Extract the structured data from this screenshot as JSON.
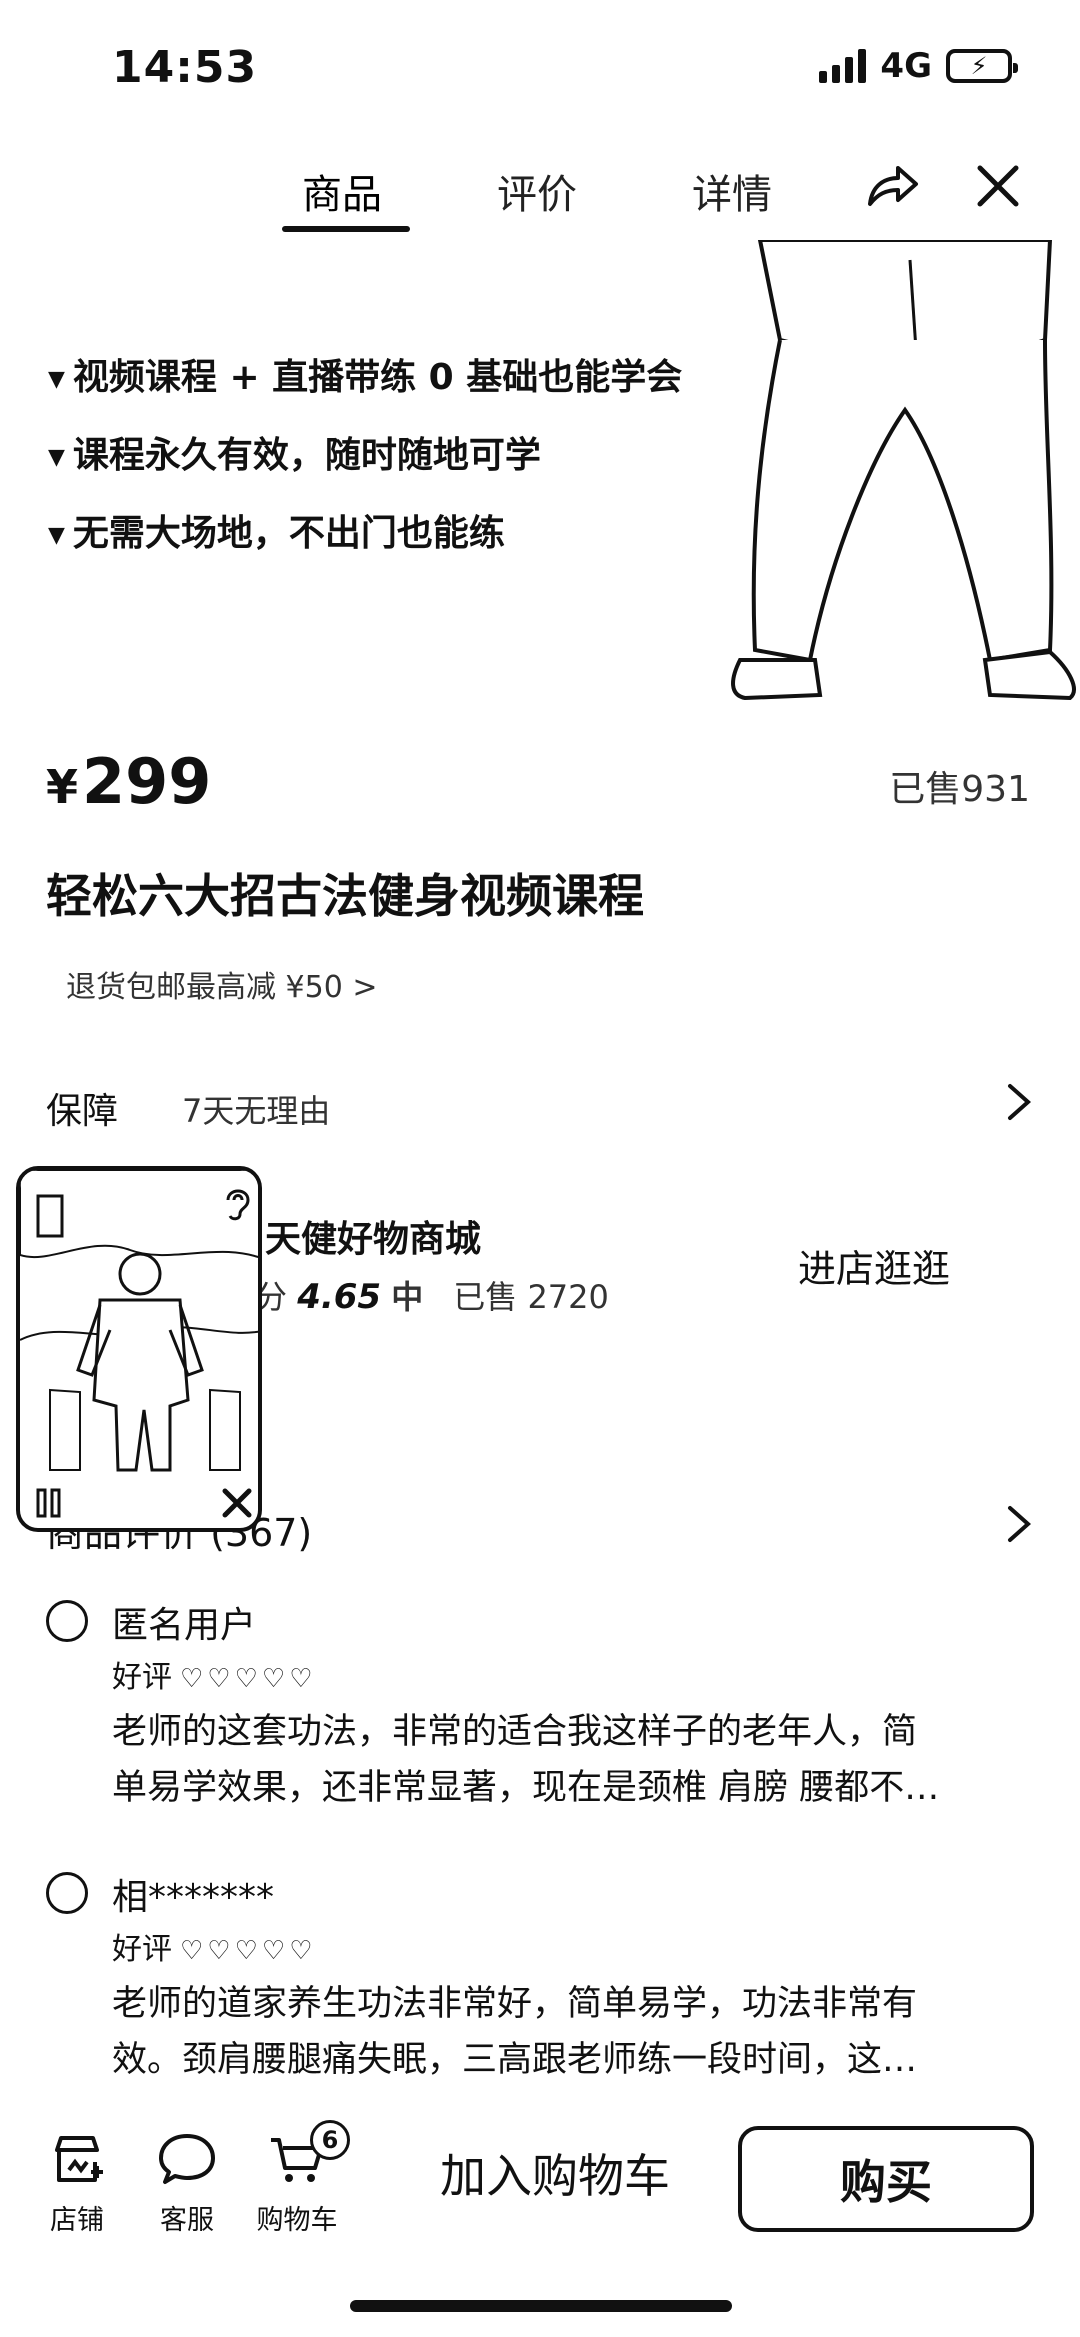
{
  "status": {
    "time": "14:53",
    "network": "4G"
  },
  "nav": {
    "tabs": [
      {
        "label": "商品",
        "active": true
      },
      {
        "label": "评价",
        "active": false
      },
      {
        "label": "详情",
        "active": false
      }
    ]
  },
  "hero": {
    "lines": [
      "视频课程 + 直播带练 0 基础也能学会",
      "课程永久有效，随时随地可学",
      "无需大场地，不出门也能练"
    ]
  },
  "product": {
    "currency": "¥",
    "price": "299",
    "sold": "已售931",
    "title": "轻松六大招古法健身视频课程",
    "promo": "退货包邮最高减 ¥50 >"
  },
  "guarantee": {
    "label": "保障",
    "value": "7天无理由"
  },
  "shop": {
    "name": "天健好物商城",
    "score_prefix": "分",
    "score": "4.65",
    "score_level": "中",
    "sold": "已售 2720",
    "enter_label": "进店逛逛"
  },
  "reviews": {
    "header": "商品评价 (367)",
    "items": [
      {
        "user": "匿名用户",
        "rating_label": "好评",
        "hearts": "♡♡♡♡♡",
        "lines": [
          "老师的这套功法，非常的适合我这样子的老年人，简",
          "单易学效果，还非常显著，现在是颈椎 肩膀 腰都不…"
        ]
      },
      {
        "user": "相*******",
        "rating_label": "好评",
        "hearts": "♡♡♡♡♡",
        "lines": [
          "老师的道家养生功法非常好，简单易学，功法非常有",
          "效。颈肩腰腿痛失眠，三高跟老师练一段时间，这…"
        ]
      }
    ]
  },
  "bottom": {
    "shop_label": "店铺",
    "service_label": "客服",
    "cart_label": "购物车",
    "cart_count": "6",
    "add_to_cart": "加入购物车",
    "buy": "购买"
  }
}
